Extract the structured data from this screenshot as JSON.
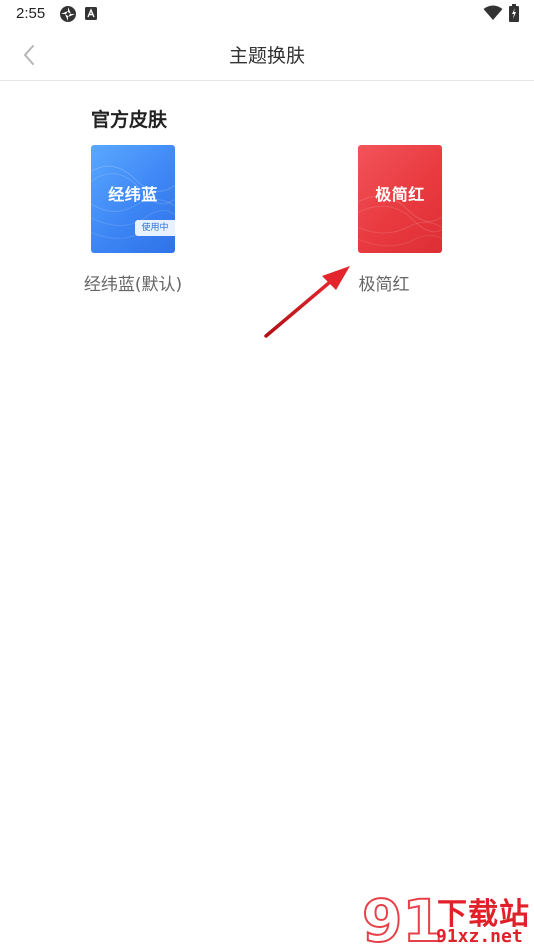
{
  "status_bar": {
    "time": "2:55",
    "icons": [
      "status-app-icon",
      "notification-a-icon",
      "wifi-icon",
      "battery-icon"
    ]
  },
  "header": {
    "title": "主题换肤",
    "back_icon": "chevron-left-icon"
  },
  "section": {
    "title": "官方皮肤"
  },
  "skins": [
    {
      "card_label": "经纬蓝",
      "caption": "经纬蓝(默认)",
      "badge": "使用中",
      "color": "#3d86f5"
    },
    {
      "card_label": "极简红",
      "caption": "极简红",
      "color": "#e83a3f"
    }
  ],
  "watermark": {
    "text": "下载站",
    "url": "91xz.net",
    "logo_digits": "91",
    "color": "#e2202a"
  },
  "annotation": {
    "arrow_color": "#d9161e"
  }
}
